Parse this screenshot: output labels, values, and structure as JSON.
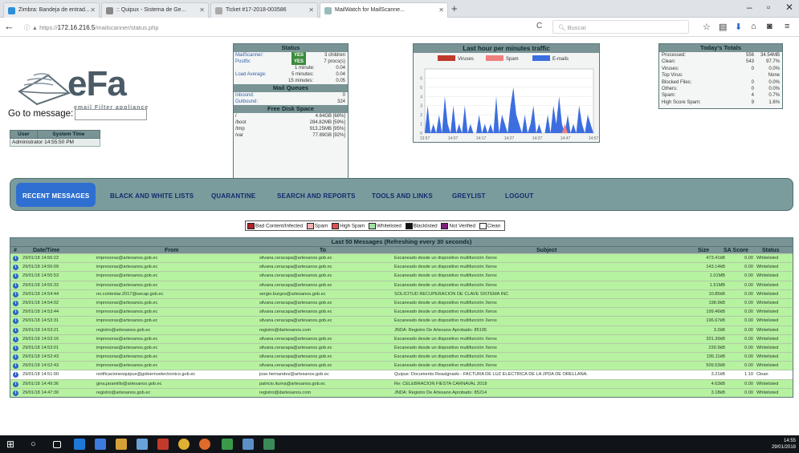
{
  "browser": {
    "tabs": [
      {
        "label": "Zimbra: Bandeja de entrad...",
        "color": "#2f8fd8"
      },
      {
        "label": ":: Quipux - Sistema de Ge...",
        "color": "#888888"
      },
      {
        "label": "Ticket #17-2018-003586",
        "color": "#aaaaaa"
      },
      {
        "label": "MailWatch for MailScanne...",
        "color": "#9bb"
      }
    ],
    "url_prefix": "https://",
    "url_host": "172.16.216.5",
    "url_path": "/mailscanner/status.php",
    "search_placeholder": "Buscar"
  },
  "logo": {
    "text": "eFa",
    "subtitle": "email Filter appliance"
  },
  "goto": {
    "label": "Go to message:",
    "value": ""
  },
  "user_table": {
    "headers": [
      "User",
      "System Time"
    ],
    "row": [
      "Administrator 14:55:50 PM"
    ]
  },
  "status": {
    "title": "Status",
    "mailscanner_label": "MailScanner:",
    "mailscanner_badge": "YES",
    "mailscanner_value": "3 children",
    "postfix_label": "Postfix:",
    "postfix_badge": "YES",
    "postfix_value": "7 procs(s)",
    "load_label": "Load Average:",
    "load": [
      {
        "k": "1 minute:",
        "v": "0.04"
      },
      {
        "k": "5 minutes:",
        "v": "0.04"
      },
      {
        "k": "15 minutes:",
        "v": "0.05"
      }
    ],
    "queues_title": "Mail Queues",
    "inbound_label": "Inbound:",
    "inbound_value": "0",
    "outbound_label": "Outbound:",
    "outbound_value": "324",
    "disk_title": "Free Disk Space",
    "disks": [
      {
        "k": "/",
        "v": "4.64GB [68%]"
      },
      {
        "k": "/boot",
        "v": "284.82MB [59%]"
      },
      {
        "k": "/tmp",
        "v": "913.25MB [95%]"
      },
      {
        "k": "/var",
        "v": "77.89GB [92%]"
      }
    ]
  },
  "traffic": {
    "title": "Last hour per minutes traffic",
    "legend": [
      "Viruses",
      "Spam",
      "E-mails"
    ],
    "colors": [
      "#c0392b",
      "#f08080",
      "#3d6ee0"
    ]
  },
  "chart_data": {
    "type": "area",
    "title": "Last hour per minutes traffic",
    "series_names": [
      "Viruses",
      "Spam",
      "E-mails"
    ],
    "x_ticks": [
      "13:57",
      "14:07",
      "14:17",
      "14:27",
      "14:37",
      "14:47",
      "14:57"
    ],
    "ylim": [
      0,
      7
    ],
    "y_ticks": [
      0,
      1,
      2,
      3,
      4,
      5,
      6
    ],
    "emails": [
      0,
      3,
      0,
      1,
      0,
      2,
      0,
      4,
      1,
      0,
      3,
      0,
      1,
      0,
      3,
      0,
      1,
      0,
      0,
      2,
      0,
      1,
      0,
      1,
      0,
      4,
      0,
      2,
      1,
      0,
      3,
      5,
      2,
      1,
      0,
      2,
      0,
      1,
      3,
      0,
      1,
      0,
      0,
      2,
      0,
      3,
      1,
      4,
      1,
      0,
      2,
      0,
      1,
      0,
      3,
      1,
      0,
      2,
      1,
      0
    ],
    "spam": [
      0,
      0,
      0,
      0,
      0,
      0,
      0,
      0,
      0,
      0,
      0,
      0,
      0,
      0,
      0,
      0,
      0,
      0,
      0,
      0,
      0,
      0,
      0,
      0,
      0,
      0,
      0,
      0,
      0,
      0,
      0,
      0,
      0,
      0,
      0,
      0,
      0,
      0,
      0,
      0,
      0,
      0,
      0,
      0,
      0,
      0,
      0,
      0,
      0,
      1,
      0,
      0,
      0,
      0,
      0,
      0,
      0,
      0,
      0,
      0
    ],
    "viruses": [
      0,
      0,
      0,
      0,
      0,
      0,
      0,
      0,
      0,
      0,
      0,
      0,
      0,
      0,
      0,
      0,
      0,
      0,
      0,
      0,
      0,
      0,
      0,
      0,
      0,
      0,
      0,
      0,
      0,
      0,
      0,
      0,
      0,
      0,
      0,
      0,
      0,
      0,
      0,
      0,
      0,
      0,
      0,
      0,
      0,
      0,
      0,
      0,
      0,
      0,
      0,
      0,
      0,
      0,
      0,
      0,
      0,
      0,
      0,
      0
    ]
  },
  "totals": {
    "title": "Today's Totals",
    "rows": [
      {
        "k": "Processed:",
        "n": "556",
        "p": "34.54MB"
      },
      {
        "k": "Clean:",
        "n": "543",
        "p": "97.7%"
      },
      {
        "k": "Viruses:",
        "n": "0",
        "p": "0.0%"
      },
      {
        "k": "Top Virus:",
        "n": "",
        "p": "None"
      },
      {
        "k": "Blocked Files:",
        "n": "0",
        "p": "0.0%"
      },
      {
        "k": "Others:",
        "n": "0",
        "p": "0.0%"
      },
      {
        "k": "Spam:",
        "n": "4",
        "p": "0.7%"
      },
      {
        "k": "High Score Spam:",
        "n": "9",
        "p": "1.6%"
      }
    ]
  },
  "menu": [
    "RECENT MESSAGES",
    "BLACK AND WHITE LISTS",
    "QUARANTINE",
    "SEARCH AND REPORTS",
    "TOOLS AND LINKS",
    "GREYLIST",
    "LOGOUT"
  ],
  "legend": [
    {
      "label": "Bad Content/Infected",
      "color": "#b22222"
    },
    {
      "label": "Spam",
      "color": "#f4b0b0"
    },
    {
      "label": "High Spam",
      "color": "#e05050"
    },
    {
      "label": "Whitelisted",
      "color": "#9fe39f"
    },
    {
      "label": "Blacklisted",
      "color": "#111111"
    },
    {
      "label": "Not Verified",
      "color": "#7d1f7d"
    },
    {
      "label": "Clean",
      "color": "#ffffff"
    }
  ],
  "messages": {
    "title": "Last 50 Messages (Refreshing every 30 seconds)",
    "headers": [
      "#",
      "Date/Time",
      "From",
      "To",
      "Subject",
      "Size",
      "SA Score",
      "Status"
    ],
    "rows": [
      {
        "date": "29/01/18 14:56:22",
        "from": "impresoras@artesanos.gob.ec",
        "to": "silvana.ceracapa@artesanos.gob.ec",
        "subject": "Escaneado desde un dispositivo multifunción Xerox",
        "size": "473.41kB",
        "sa": "0.00",
        "status": "Whitelisted",
        "bg": "#b6f2a0"
      },
      {
        "date": "29/01/18 14:56:09",
        "from": "impresoras@artesanos.gob.ec",
        "to": "silvana.ceracapa@artesanos.gob.ec",
        "subject": "Escaneado desde un dispositivo multifunción Xerox",
        "size": "143.14kB",
        "sa": "0.00",
        "status": "Whitelisted",
        "bg": "#b6f2a0"
      },
      {
        "date": "29/01/18 14:55:53",
        "from": "impresoras@artesanos.gob.ec",
        "to": "silvana.ceracapa@artesanos.gob.ec",
        "subject": "Escaneado desde un dispositivo multifunción Xerox",
        "size": "1.01MB",
        "sa": "0.00",
        "status": "Whitelisted",
        "bg": "#b6f2a0"
      },
      {
        "date": "29/01/18 14:55:33",
        "from": "impresoras@artesanos.gob.ec",
        "to": "silvana.ceracapa@artesanos.gob.ec",
        "subject": "Escaneado desde un dispositivo multifunción Xerox",
        "size": "1.51MB",
        "sa": "0.00",
        "status": "Whitelisted",
        "bg": "#b6f2a0"
      },
      {
        "date": "29/01/18 14:54:44",
        "from": "no.contestar.2017@secap.gob.ec",
        "to": "sergio.burgos@artesanos.gob.ec",
        "subject": "SOLICITUD RECUPERACION DE CLAVE SISTEMA INC",
        "size": "10.85kB",
        "sa": "0.00",
        "status": "Whitelisted",
        "bg": "#b6f2a0"
      },
      {
        "date": "29/01/18 14:54:02",
        "from": "impresoras@artesanos.gob.ec",
        "to": "silvana.ceracapa@artesanos.gob.ec",
        "subject": "Escaneado desde un dispositivo multifunción Xerox",
        "size": "198.9kB",
        "sa": "0.00",
        "status": "Whitelisted",
        "bg": "#b6f2a0"
      },
      {
        "date": "29/01/18 14:53:44",
        "from": "impresoras@artesanos.gob.ec",
        "to": "silvana.ceracapa@artesanos.gob.ec",
        "subject": "Escaneado desde un dispositivo multifunción Xerox",
        "size": "199.46kB",
        "sa": "0.00",
        "status": "Whitelisted",
        "bg": "#b6f2a0"
      },
      {
        "date": "29/01/18 14:53:31",
        "from": "impresoras@artesanos.gob.ec",
        "to": "silvana.ceracapa@artesanos.gob.ec",
        "subject": "Escaneado desde un dispositivo multifunción Xerox",
        "size": "196.67kB",
        "sa": "0.00",
        "status": "Whitelisted",
        "bg": "#b6f2a0"
      },
      {
        "date": "29/01/18 14:53:21",
        "from": "registro@artesanos.gob.ec",
        "to": "registro@dartesanos.com",
        "subject": "JNDA: Registro De Artesano Aprobado: 85195",
        "size": "3.2kB",
        "sa": "0.00",
        "status": "Whitelisted",
        "bg": "#b6f2a0"
      },
      {
        "date": "29/01/18 14:53:16",
        "from": "impresoras@artesanos.gob.ec",
        "to": "silvana.ceracapa@artesanos.gob.ec",
        "subject": "Escaneado desde un dispositivo multifunción Xerox",
        "size": "201.39kB",
        "sa": "0.00",
        "status": "Whitelisted",
        "bg": "#b6f2a0"
      },
      {
        "date": "29/01/18 14:53:01",
        "from": "impresoras@artesanos.gob.ec",
        "to": "silvana.ceracapa@artesanos.gob.ec",
        "subject": "Escaneado desde un dispositivo multifunción Xerox",
        "size": "230.9kB",
        "sa": "0.00",
        "status": "Whitelisted",
        "bg": "#b6f2a0"
      },
      {
        "date": "29/01/18 14:52:43",
        "from": "impresoras@artesanos.gob.ec",
        "to": "silvana.ceracapa@artesanos.gob.ec",
        "subject": "Escaneado desde un dispositivo multifunción Xerox",
        "size": "195.11kB",
        "sa": "0.00",
        "status": "Whitelisted",
        "bg": "#b6f2a0"
      },
      {
        "date": "29/01/18 14:52:43",
        "from": "impresoras@artesanos.gob.ec",
        "to": "silvana.ceracapa@artesanos.gob.ec",
        "subject": "Escaneado desde un dispositivo multifunción Xerox",
        "size": "509.53kB",
        "sa": "0.00",
        "status": "Whitelisted",
        "bg": "#b6f2a0"
      },
      {
        "date": "29/01/18 14:51:00",
        "from": "notificacionesquipux@gobiernoelectronico.gob.ec",
        "to": "jose.hernandez@artesanos.gob.ec",
        "subject": "Quipux: Documento Reasignado - FACTURA DE LUZ ELECTRICA DE LA JPDA DE ORELLANA.",
        "size": "3.21kB",
        "sa": "1.10",
        "status": "Clean",
        "bg": "#ffffff"
      },
      {
        "date": "29/01/18 14:49:36",
        "from": "gina.jaramillo@artesanos.gob.ec",
        "to": "patricio.iturna@artesanos.gob.ec",
        "subject": "Re: CELEBRACION FIESTA CARNAVAL 2018",
        "size": "4.63kB",
        "sa": "0.00",
        "status": "Whitelisted",
        "bg": "#b6f2a0"
      },
      {
        "date": "29/01/18 14:47:30",
        "from": "registro@artesanos.gob.ec",
        "to": "registro@dartesanos.com",
        "subject": "JNDA: Registro De Artesano Aprobado: 85214",
        "size": "3.18kB",
        "sa": "0.00",
        "status": "Whitelisted",
        "bg": "#b6f2a0"
      }
    ]
  },
  "taskbar": {
    "time": "14:55",
    "date": "29/01/2018"
  }
}
